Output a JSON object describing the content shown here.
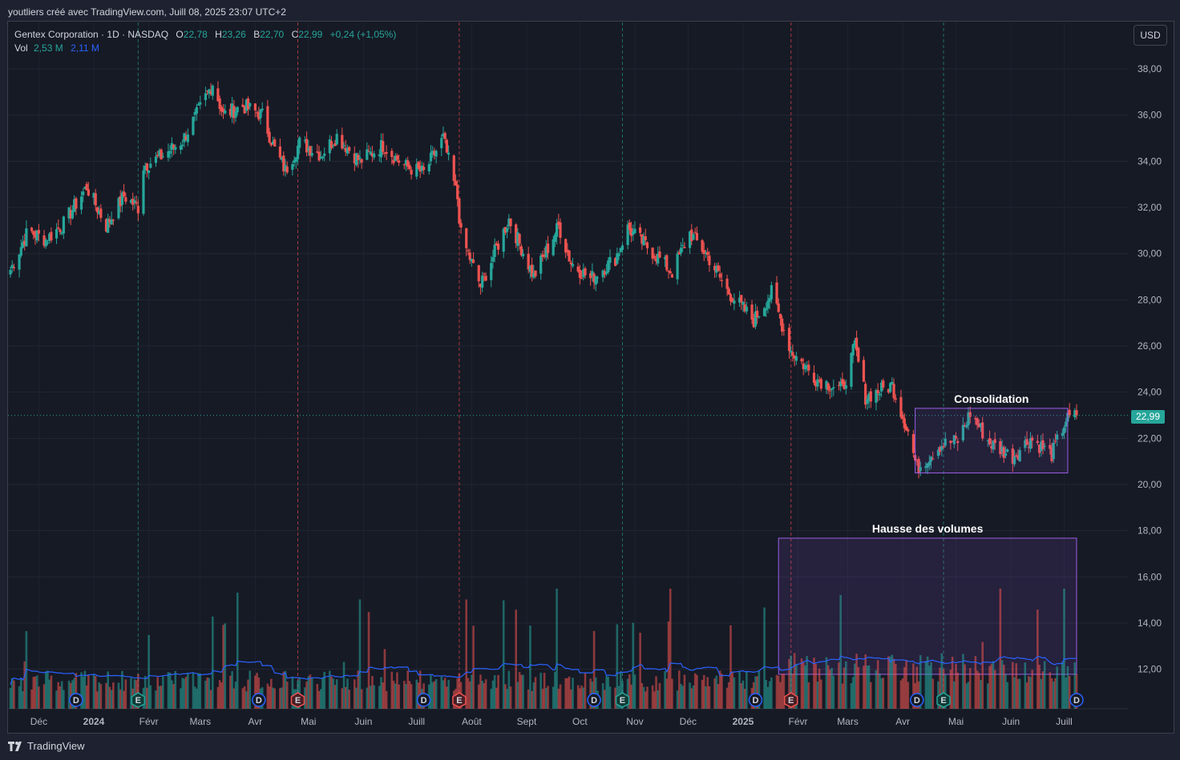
{
  "header": {
    "credit": "youtliers créé avec TradingView.com, Juill 08, 2025 23:07 UTC+2"
  },
  "legend": {
    "symbol": "Gentex Corporation · 1D · NASDAQ",
    "o_label": "O",
    "o_value": "22,78",
    "h_label": "H",
    "h_value": "23,26",
    "b_label": "B",
    "b_value": "22,70",
    "c_label": "C",
    "c_value": "22,99",
    "change": "+0,24 (+1,05%)",
    "vol_label": "Vol",
    "vol_value": "2,53 M",
    "vol_ma_value": "2,11 M"
  },
  "currency_button": "USD",
  "last_price": "22,99",
  "footer": {
    "brand": "TradingView"
  },
  "colors": {
    "up": "#26a69a",
    "down": "#ef5350",
    "volume_ma": "#2962ff",
    "box": "#9c5de8",
    "background": "#161a25"
  },
  "chart_data": {
    "type": "candlestick",
    "title": "",
    "ylim": [
      20,
      38
    ],
    "y_ticks": [
      "38,00",
      "36,00",
      "34,00",
      "32,00",
      "30,00",
      "28,00",
      "26,00",
      "24,00",
      "22,00",
      "20,00",
      "18,00",
      "16,00",
      "14,00",
      "12,00"
    ],
    "x_ticks": [
      "Déc",
      "2024",
      "Févr",
      "Mars",
      "Avr",
      "Mai",
      "Juin",
      "Juill",
      "Août",
      "Sept",
      "Oct",
      "Nov",
      "Déc",
      "2025",
      "Févr",
      "Mars",
      "Avr",
      "Mai",
      "Juin",
      "Juill"
    ],
    "price_series": [
      {
        "date": "2023-11-15",
        "close": 29.3
      },
      {
        "date": "2023-11-25",
        "close": 31.0
      },
      {
        "date": "2023-12-05",
        "close": 30.6
      },
      {
        "date": "2023-12-15",
        "close": 31.3
      },
      {
        "date": "2023-12-28",
        "close": 32.9
      },
      {
        "date": "2024-01-08",
        "close": 31.2
      },
      {
        "date": "2024-01-18",
        "close": 32.5
      },
      {
        "date": "2024-01-26",
        "close": 32.0
      },
      {
        "date": "2024-01-29",
        "close": 33.8
      },
      {
        "date": "2024-02-08",
        "close": 34.2
      },
      {
        "date": "2024-02-20",
        "close": 34.9
      },
      {
        "date": "2024-03-01",
        "close": 36.3
      },
      {
        "date": "2024-03-08",
        "close": 37.4
      },
      {
        "date": "2024-03-14",
        "close": 36.0
      },
      {
        "date": "2024-03-25",
        "close": 36.4
      },
      {
        "date": "2024-04-05",
        "close": 36.0
      },
      {
        "date": "2024-04-12",
        "close": 34.5
      },
      {
        "date": "2024-04-18",
        "close": 33.6
      },
      {
        "date": "2024-04-26",
        "close": 34.8
      },
      {
        "date": "2024-05-08",
        "close": 34.3
      },
      {
        "date": "2024-05-17",
        "close": 35.1
      },
      {
        "date": "2024-05-30",
        "close": 34.0
      },
      {
        "date": "2024-06-12",
        "close": 34.7
      },
      {
        "date": "2024-06-24",
        "close": 33.8
      },
      {
        "date": "2024-07-05",
        "close": 33.5
      },
      {
        "date": "2024-07-16",
        "close": 35.0
      },
      {
        "date": "2024-07-24",
        "close": 32.4
      },
      {
        "date": "2024-07-26",
        "close": 30.8
      },
      {
        "date": "2024-08-06",
        "close": 28.6
      },
      {
        "date": "2024-08-22",
        "close": 31.5
      },
      {
        "date": "2024-09-05",
        "close": 29.0
      },
      {
        "date": "2024-09-19",
        "close": 31.2
      },
      {
        "date": "2024-09-26",
        "close": 29.6
      },
      {
        "date": "2024-10-07",
        "close": 28.9
      },
      {
        "date": "2024-10-21",
        "close": 29.8
      },
      {
        "date": "2024-10-28",
        "close": 31.1
      },
      {
        "date": "2024-11-12",
        "close": 30.0
      },
      {
        "date": "2024-11-22",
        "close": 29.2
      },
      {
        "date": "2024-12-02",
        "close": 30.9
      },
      {
        "date": "2024-12-12",
        "close": 29.9
      },
      {
        "date": "2024-12-23",
        "close": 28.4
      },
      {
        "date": "2025-01-07",
        "close": 27.1
      },
      {
        "date": "2025-01-17",
        "close": 28.3
      },
      {
        "date": "2025-01-28",
        "close": 25.8
      },
      {
        "date": "2025-02-11",
        "close": 24.6
      },
      {
        "date": "2025-02-26",
        "close": 24.1
      },
      {
        "date": "2025-03-05",
        "close": 26.0
      },
      {
        "date": "2025-03-11",
        "close": 23.8
      },
      {
        "date": "2025-03-26",
        "close": 24.3
      },
      {
        "date": "2025-04-04",
        "close": 22.3
      },
      {
        "date": "2025-04-09",
        "close": 20.7
      },
      {
        "date": "2025-04-22",
        "close": 21.7
      },
      {
        "date": "2025-05-02",
        "close": 21.9
      },
      {
        "date": "2025-05-09",
        "close": 23.1
      },
      {
        "date": "2025-05-20",
        "close": 21.8
      },
      {
        "date": "2025-06-02",
        "close": 21.2
      },
      {
        "date": "2025-06-12",
        "close": 22.0
      },
      {
        "date": "2025-06-24",
        "close": 21.3
      },
      {
        "date": "2025-07-02",
        "close": 22.8
      },
      {
        "date": "2025-07-08",
        "close": 22.99
      }
    ],
    "volume_note": "Vol",
    "annotations": [
      {
        "text": "Consolidation",
        "from_date": "2025-04-08",
        "to_date": "2025-07-03",
        "price_low": 20.5,
        "price_high": 23.3
      },
      {
        "text": "Hausse des volumes",
        "from_date": "2025-01-21",
        "to_date": "2025-07-08",
        "region": "volume"
      }
    ],
    "events": [
      {
        "date": "2023-12-22",
        "type": "D"
      },
      {
        "date": "2024-01-26",
        "type": "E"
      },
      {
        "date": "2024-04-03",
        "type": "D"
      },
      {
        "date": "2024-04-25",
        "type": "E"
      },
      {
        "date": "2024-07-05",
        "type": "D"
      },
      {
        "date": "2024-07-25",
        "type": "E"
      },
      {
        "date": "2024-10-09",
        "type": "D"
      },
      {
        "date": "2024-10-25",
        "type": "E"
      },
      {
        "date": "2025-01-08",
        "type": "D"
      },
      {
        "date": "2025-01-28",
        "type": "E"
      },
      {
        "date": "2025-04-09",
        "type": "D"
      },
      {
        "date": "2025-04-24",
        "type": "E"
      },
      {
        "date": "2025-07-08",
        "type": "D"
      }
    ],
    "grid": true
  }
}
